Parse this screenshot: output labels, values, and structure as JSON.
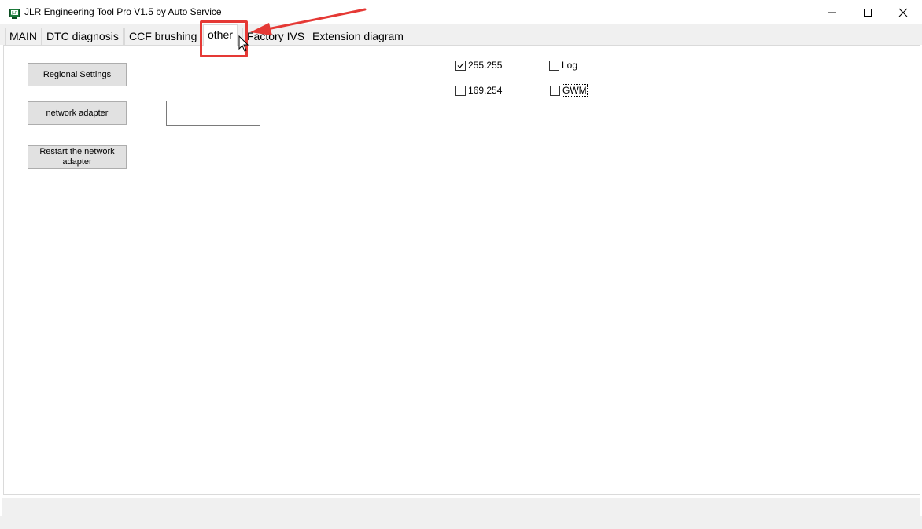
{
  "window": {
    "title": "JLR Engineering Tool Pro V1.5 by Auto Service"
  },
  "tabs": [
    {
      "label": "MAIN",
      "active": false
    },
    {
      "label": "DTC diagnosis",
      "active": false
    },
    {
      "label": "CCF brushing",
      "active": false
    },
    {
      "label": "other",
      "active": true
    },
    {
      "label": "Factory IVS",
      "active": false
    },
    {
      "label": "Extension diagram",
      "active": false
    }
  ],
  "other_tab": {
    "regional_settings_label": "Regional Settings",
    "network_adapter_label": "network adapter",
    "network_adapter_value": "",
    "restart_adapter_label": "Restart the network adapter",
    "checkboxes": {
      "ip_255": {
        "label": "255.255",
        "checked": true
      },
      "ip_169": {
        "label": "169.254",
        "checked": false
      },
      "log": {
        "label": "Log",
        "checked": false
      },
      "gwm": {
        "label": "GWM",
        "checked": false
      }
    }
  },
  "annotation": {
    "highlight_color": "#e53935"
  }
}
